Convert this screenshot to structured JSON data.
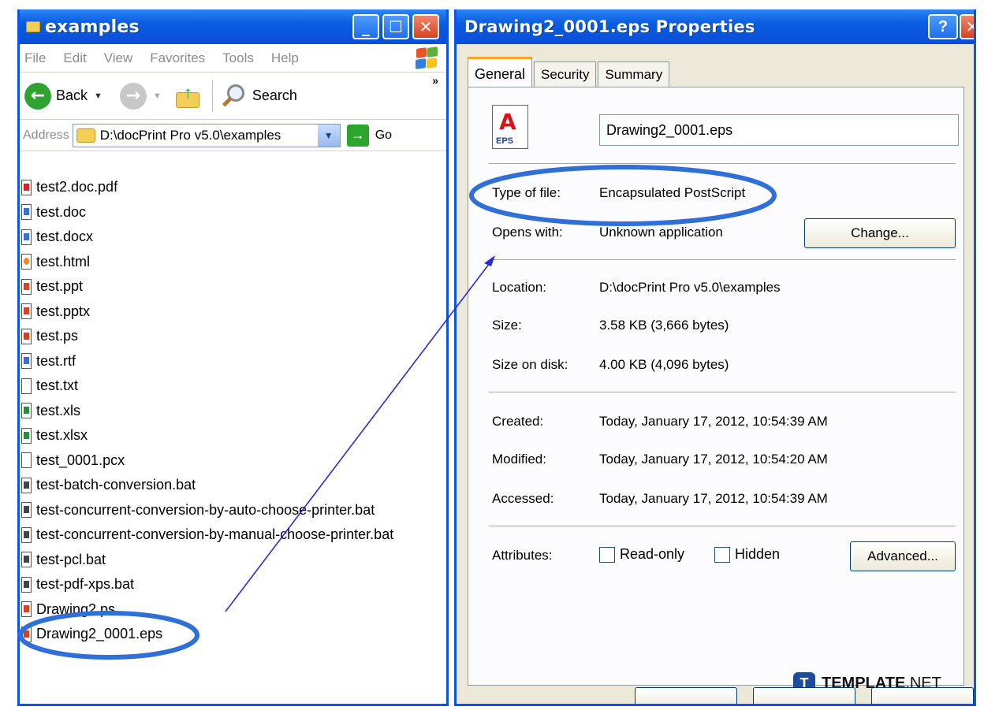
{
  "explorer": {
    "title": "examples",
    "min_icon": "_",
    "max_icon": "☐",
    "close_icon": "✕",
    "menu": [
      "File",
      "Edit",
      "View",
      "Favorites",
      "Tools",
      "Help"
    ],
    "chevron": "»",
    "toolbar": {
      "back_label": "Back",
      "search_label": "Search"
    },
    "address": {
      "label": "Address",
      "path": "D:\\docPrint Pro v5.0\\examples",
      "go_label": "Go"
    },
    "files": [
      {
        "name": "test2.doc.pdf",
        "icon": "pdf"
      },
      {
        "name": "test.doc",
        "icon": "doc"
      },
      {
        "name": "test.docx",
        "icon": "doc"
      },
      {
        "name": "test.html",
        "icon": "html"
      },
      {
        "name": "test.ppt",
        "icon": "ppt"
      },
      {
        "name": "test.pptx",
        "icon": "ppt"
      },
      {
        "name": "test.ps",
        "icon": "ps"
      },
      {
        "name": "test.rtf",
        "icon": "doc"
      },
      {
        "name": "test.txt",
        "icon": "txt"
      },
      {
        "name": "test.xls",
        "icon": "xls"
      },
      {
        "name": "test.xlsx",
        "icon": "xls"
      },
      {
        "name": "test_0001.pcx",
        "icon": "txt"
      },
      {
        "name": "test-batch-conversion.bat",
        "icon": "bat"
      },
      {
        "name": "test-concurrent-conversion-by-auto-choose-printer.bat",
        "icon": "bat"
      },
      {
        "name": "test-concurrent-conversion-by-manual-choose-printer.bat",
        "icon": "bat"
      },
      {
        "name": "test-pcl.bat",
        "icon": "bat"
      },
      {
        "name": "test-pdf-xps.bat",
        "icon": "bat"
      },
      {
        "name": "Drawing2.ps",
        "icon": "ps"
      },
      {
        "name": "Drawing2_0001.eps",
        "icon": "ps"
      }
    ]
  },
  "properties": {
    "title": "Drawing2_0001.eps Properties",
    "help_icon": "?",
    "close_icon": "✕",
    "tabs": [
      "General",
      "Security",
      "Summary"
    ],
    "icon_label": "EPS",
    "filename": "Drawing2_0001.eps",
    "type_label": "Type of file:",
    "type_value": "Encapsulated PostScript",
    "opens_label": "Opens with:",
    "opens_value": "Unknown application",
    "change_button": "Change...",
    "location_label": "Location:",
    "location_value": "D:\\docPrint Pro v5.0\\examples",
    "size_label": "Size:",
    "size_value": "3.58 KB (3,666 bytes)",
    "sizeondisk_label": "Size on disk:",
    "sizeondisk_value": "4.00 KB (4,096 bytes)",
    "created_label": "Created:",
    "created_value": "Today, January 17, 2012, 10:54:39 AM",
    "modified_label": "Modified:",
    "modified_value": "Today, January 17, 2012, 10:54:20 AM",
    "accessed_label": "Accessed:",
    "accessed_value": "Today, January 17, 2012, 10:54:39 AM",
    "attributes_label": "Attributes:",
    "readonly_label": "Read-only",
    "hidden_label": "Hidden",
    "advanced_button": "Advanced..."
  },
  "watermark": {
    "badge": "T",
    "brand": "TEMPLATE",
    "suffix": ".NET"
  },
  "colors": {
    "xp_blue": "#0a55e8",
    "annotation_blue": "#2f6fd6",
    "arrow_blue": "#2a2ad0"
  }
}
